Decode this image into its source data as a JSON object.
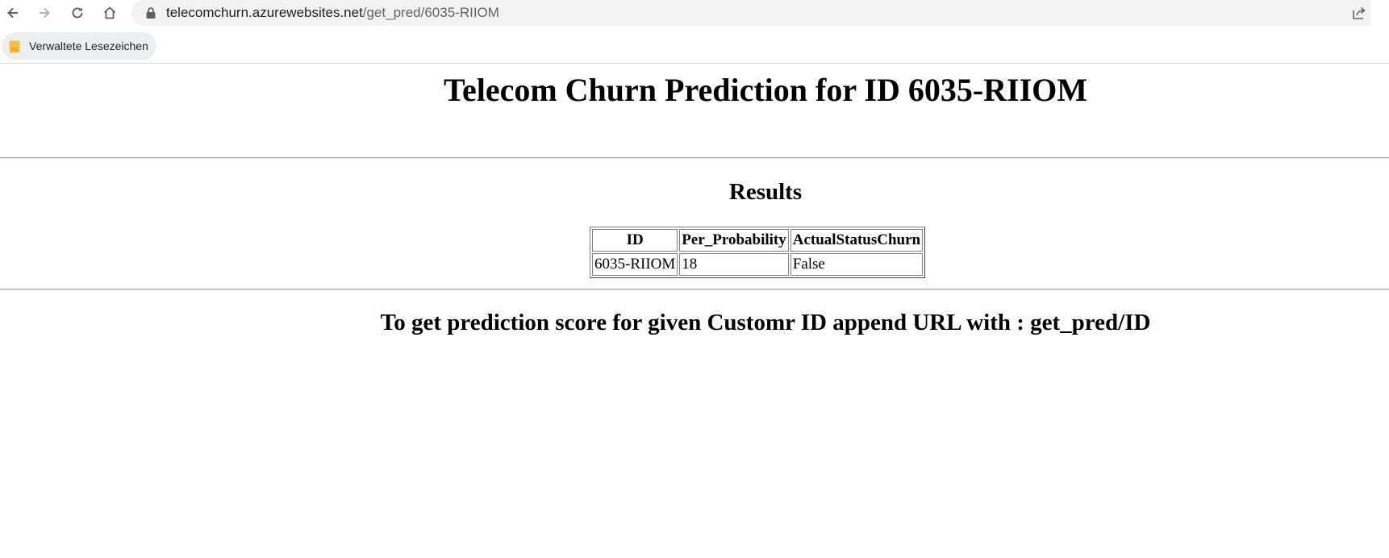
{
  "browser": {
    "url_host": "telecomchurn.azurewebsites.net",
    "url_path": "/get_pred/6035-RIIOM",
    "bookmark_folder_label": "Verwaltete Lesezeichen",
    "icons": [
      "back-icon",
      "forward-icon",
      "reload-icon",
      "home-icon",
      "lock-icon",
      "share-icon",
      "folder-icon"
    ]
  },
  "page": {
    "title": "Telecom Churn Prediction for ID 6035-RIIOM",
    "results_heading": "Results",
    "table": {
      "headers": [
        "ID",
        "Per_Probability",
        "ActualStatusChurn"
      ],
      "rows": [
        [
          "6035-RIIOM",
          "18",
          "False"
        ]
      ]
    },
    "hint": "To get prediction score for given Customr ID append URL with : get_pred/ID"
  }
}
